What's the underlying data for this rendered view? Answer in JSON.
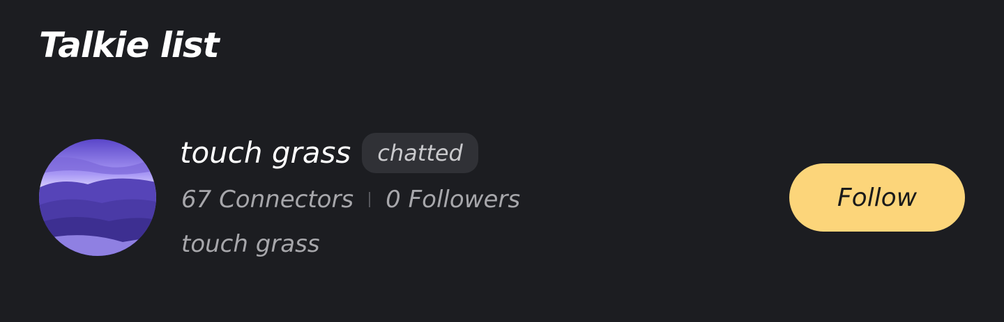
{
  "page": {
    "section_title": "Talkie list"
  },
  "talkie": {
    "name": "touch grass",
    "badge": "chatted",
    "connectors": "67 Connectors",
    "followers": "0 Followers",
    "description": "touch grass",
    "follow_label": "Follow"
  },
  "colors": {
    "background": "#1c1d21",
    "accent": "#fcd57a",
    "badge_bg": "#303136"
  }
}
